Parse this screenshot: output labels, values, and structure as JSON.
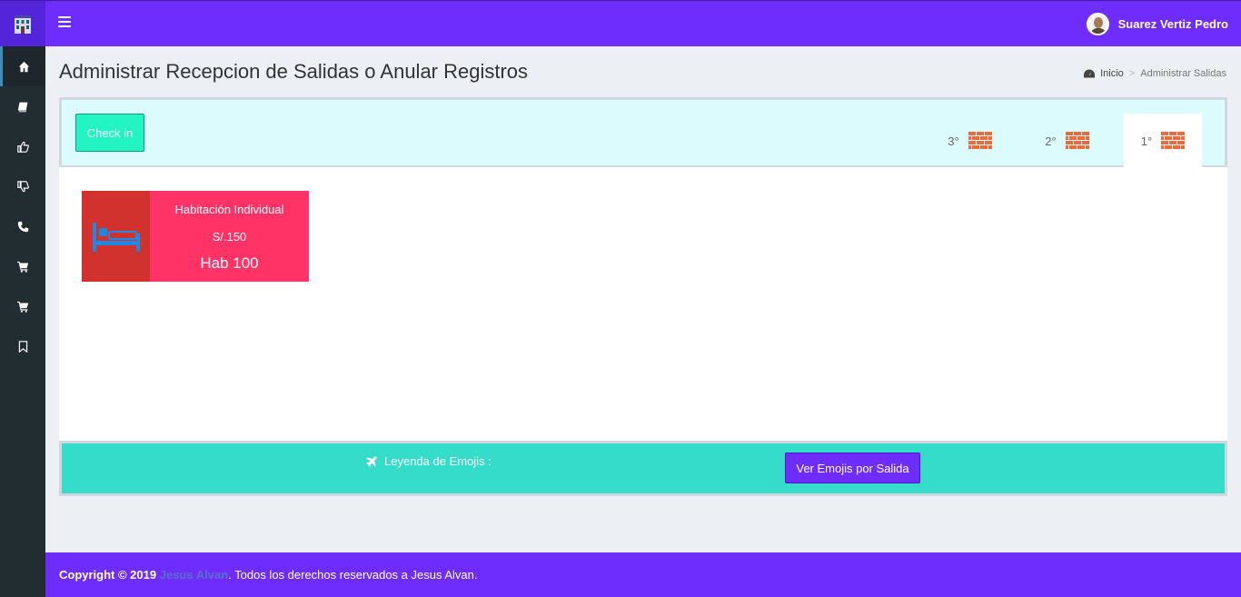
{
  "header": {
    "menu_icon": "hamburger-icon",
    "user_name": "Suarez Vertiz Pedro",
    "brand_color": "#6e2cfd"
  },
  "sidebar": {
    "items": [
      {
        "icon": "home-icon",
        "active": true
      },
      {
        "icon": "book-icon"
      },
      {
        "icon": "thumbs-up-icon"
      },
      {
        "icon": "thumbs-down-icon"
      },
      {
        "icon": "phone-icon"
      },
      {
        "icon": "cart-icon"
      },
      {
        "icon": "cart-icon"
      },
      {
        "icon": "bookmark-icon"
      }
    ]
  },
  "page": {
    "title": "Administrar Recepcion de Salidas o Anular Registros",
    "breadcrumb_home": "Inicio",
    "breadcrumb_sep": ">",
    "breadcrumb_current": "Administrar Salidas"
  },
  "toolbar": {
    "checkin_label": "Check in",
    "floors": [
      {
        "label": "3°",
        "icon": "brick-wall-icon"
      },
      {
        "label": "2°",
        "icon": "brick-wall-icon"
      },
      {
        "label": "1°",
        "icon": "brick-wall-icon",
        "active": true
      }
    ]
  },
  "rooms": [
    {
      "type": "Habitación Individual",
      "price": "S/.150",
      "number": "Hab 100",
      "icon": "bed-icon",
      "color": "#ff3366"
    }
  ],
  "legend": {
    "label": "Leyenda de Emojis :",
    "icon": "plane-icon",
    "button_label": "Ver Emojis por Salida"
  },
  "footer": {
    "prefix": "Copyright © 2019",
    "author": "Jesus Alvan",
    "suffix": ". Todos los derechos reservados a Jesus Alvan."
  }
}
